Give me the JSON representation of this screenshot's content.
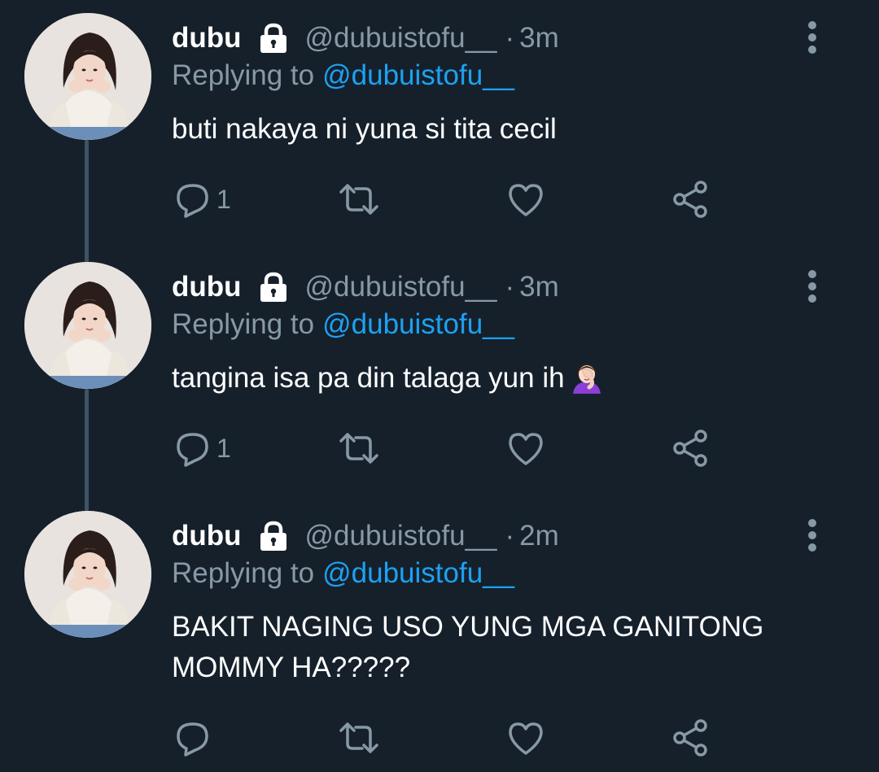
{
  "tweets": [
    {
      "display_name": "dubu",
      "handle": "@dubuistofu__",
      "separator": "·",
      "time": "3m",
      "replying_prefix": "Replying to",
      "replying_handle": "@dubuistofu__",
      "text": "buti nakaya ni yuna si tita cecil",
      "reply_count": "1",
      "has_emoji": false
    },
    {
      "display_name": "dubu",
      "handle": "@dubuistofu__",
      "separator": "·",
      "time": "3m",
      "replying_prefix": "Replying to",
      "replying_handle": "@dubuistofu__",
      "text": "tangina isa pa din talaga yun ih",
      "reply_count": "1",
      "has_emoji": true
    },
    {
      "display_name": "dubu",
      "handle": "@dubuistofu__",
      "separator": "·",
      "time": "2m",
      "replying_prefix": "Replying to",
      "replying_handle": "@dubuistofu__",
      "text": "BAKIT NAGING USO YUNG MGA GANITONG\nMOMMY HA?????",
      "reply_count": "",
      "has_emoji": false
    }
  ],
  "colors": {
    "background": "#15202b",
    "text": "#ffffff",
    "secondary": "#8899a6",
    "link": "#1da1f2",
    "thread_line": "#3d5466"
  },
  "icons": [
    "lock-icon",
    "more-vertical-icon",
    "reply-icon",
    "retweet-icon",
    "like-icon",
    "share-icon",
    "facepalm-emoji"
  ]
}
